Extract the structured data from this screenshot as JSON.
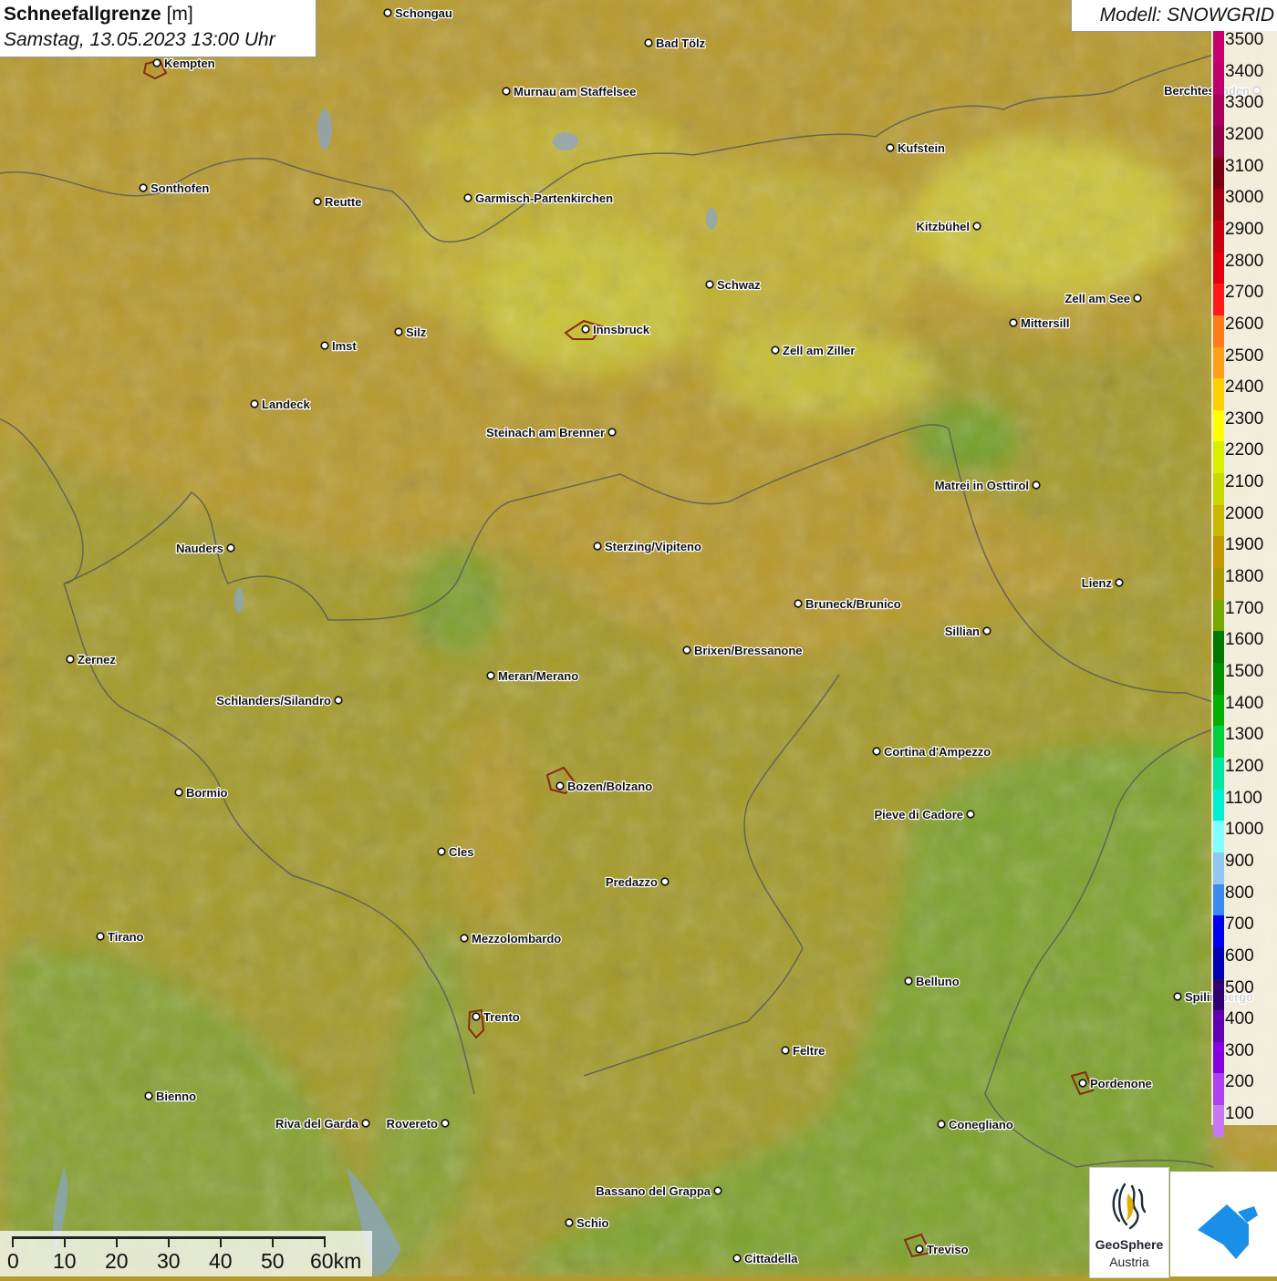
{
  "header": {
    "title": "Schneefallgrenze",
    "unit": "[m]",
    "datetime": "Samstag, 13.05.2023 13:00 Uhr",
    "model": "Modell: SNOWGRID"
  },
  "legend": {
    "unit": "m",
    "entries": [
      {
        "label": "3500",
        "color": "#c8006e"
      },
      {
        "label": "3400",
        "color": "#c0006a"
      },
      {
        "label": "3300",
        "color": "#a8005a"
      },
      {
        "label": "3200",
        "color": "#900048"
      },
      {
        "label": "3100",
        "color": "#780010"
      },
      {
        "label": "3000",
        "color": "#a00010"
      },
      {
        "label": "2900",
        "color": "#c80010"
      },
      {
        "label": "2800",
        "color": "#e00010"
      },
      {
        "label": "2700",
        "color": "#ff1a1a"
      },
      {
        "label": "2600",
        "color": "#ff7a1a"
      },
      {
        "label": "2500",
        "color": "#ffa01a"
      },
      {
        "label": "2400",
        "color": "#ffd000"
      },
      {
        "label": "2300",
        "color": "#ffff00"
      },
      {
        "label": "2200",
        "color": "#d8f000"
      },
      {
        "label": "2100",
        "color": "#c8d800"
      },
      {
        "label": "2000",
        "color": "#c8b800"
      },
      {
        "label": "1900",
        "color": "#c09800"
      },
      {
        "label": "1800",
        "color": "#a89a00"
      },
      {
        "label": "1700",
        "color": "#78a800"
      },
      {
        "label": "1600",
        "color": "#007800"
      },
      {
        "label": "1500",
        "color": "#009000"
      },
      {
        "label": "1400",
        "color": "#00b000"
      },
      {
        "label": "1300",
        "color": "#00d040"
      },
      {
        "label": "1200",
        "color": "#00e8a0"
      },
      {
        "label": "1100",
        "color": "#00f0d0"
      },
      {
        "label": "1000",
        "color": "#80ffff"
      },
      {
        "label": "900",
        "color": "#90c8f0"
      },
      {
        "label": "800",
        "color": "#3c8cf0"
      },
      {
        "label": "700",
        "color": "#0000f0"
      },
      {
        "label": "600",
        "color": "#0000b0"
      },
      {
        "label": "500",
        "color": "#300070"
      },
      {
        "label": "400",
        "color": "#6000b0"
      },
      {
        "label": "300",
        "color": "#8800e0"
      },
      {
        "label": "200",
        "color": "#b040f0"
      },
      {
        "label": "100",
        "color": "#c878f0"
      }
    ]
  },
  "scale": {
    "labels": [
      "0",
      "10",
      "20",
      "30",
      "40",
      "50",
      "60km"
    ]
  },
  "cities": [
    {
      "name": "Schongau"
    },
    {
      "name": "Kempten"
    },
    {
      "name": "Bad Tölz"
    },
    {
      "name": "Murnau am Staffelsee"
    },
    {
      "name": "Sonthofen"
    },
    {
      "name": "Reutte"
    },
    {
      "name": "Garmisch-Partenkirchen"
    },
    {
      "name": "Kufstein"
    },
    {
      "name": "Kitzbühel"
    },
    {
      "name": "Berchtesgaden"
    },
    {
      "name": "Schwaz"
    },
    {
      "name": "Zell am See"
    },
    {
      "name": "Mittersill"
    },
    {
      "name": "Innsbruck"
    },
    {
      "name": "Imst"
    },
    {
      "name": "Silz"
    },
    {
      "name": "Zell am Ziller"
    },
    {
      "name": "Landeck"
    },
    {
      "name": "Steinach am Brenner"
    },
    {
      "name": "Matrei in Osttirol"
    },
    {
      "name": "Nauders"
    },
    {
      "name": "Sterzing/Vipiteno"
    },
    {
      "name": "Lienz"
    },
    {
      "name": "Bruneck/Brunico"
    },
    {
      "name": "Sillian"
    },
    {
      "name": "Brixen/Bressanone"
    },
    {
      "name": "Zernez"
    },
    {
      "name": "Meran/Merano"
    },
    {
      "name": "Schlanders/Silandro"
    },
    {
      "name": "Cortina d'Ampezzo"
    },
    {
      "name": "Bozen/Bolzano"
    },
    {
      "name": "Bormio"
    },
    {
      "name": "Pieve di Cadore"
    },
    {
      "name": "Cles"
    },
    {
      "name": "Predazzo"
    },
    {
      "name": "Tirano"
    },
    {
      "name": "Mezzolombardo"
    },
    {
      "name": "Belluno"
    },
    {
      "name": "Spilimbergo"
    },
    {
      "name": "Trento"
    },
    {
      "name": "Feltre"
    },
    {
      "name": "Bienno"
    },
    {
      "name": "Pordenone"
    },
    {
      "name": "Riva del Garda"
    },
    {
      "name": "Rovereto"
    },
    {
      "name": "Conegliano"
    },
    {
      "name": "Bassano del Grappa"
    },
    {
      "name": "Schio"
    },
    {
      "name": "Treviso"
    },
    {
      "name": "Cittadella"
    }
  ],
  "logos": {
    "geosphere_name": "GeoSphere",
    "geosphere_sub": "Austria"
  }
}
